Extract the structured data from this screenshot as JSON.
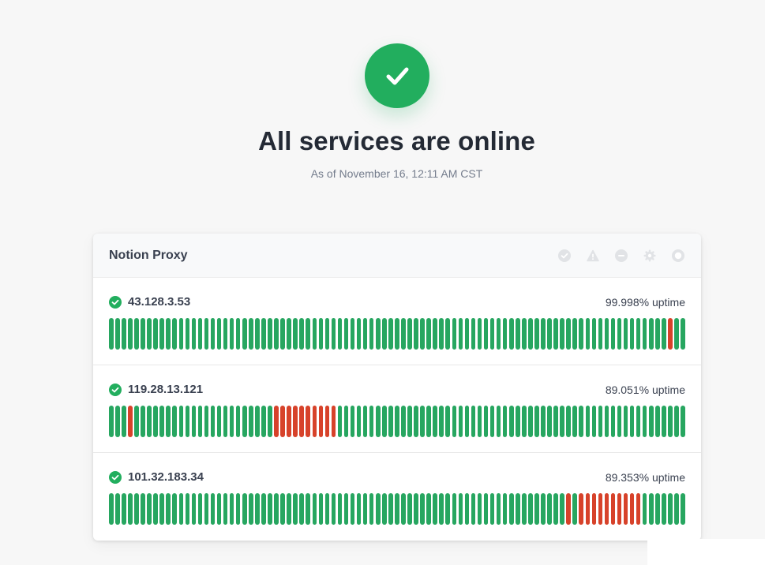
{
  "hero": {
    "status_title": "All services are online",
    "as_of": "As of November 16, 12:11 AM CST"
  },
  "group": {
    "title": "Notion Proxy",
    "legend_icons": [
      "operational-icon",
      "degraded-icon",
      "outage-icon",
      "maintenance-icon",
      "unknown-icon"
    ]
  },
  "colors": {
    "up": "#27a660",
    "down": "#d7422a",
    "accent": "#22ae5e"
  },
  "monitors": [
    {
      "name": "43.128.3.53",
      "uptime": "99.998% uptime",
      "bars": [
        1,
        1,
        1,
        1,
        1,
        1,
        1,
        1,
        1,
        1,
        1,
        1,
        1,
        1,
        1,
        1,
        1,
        1,
        1,
        1,
        1,
        1,
        1,
        1,
        1,
        1,
        1,
        1,
        1,
        1,
        1,
        1,
        1,
        1,
        1,
        1,
        1,
        1,
        1,
        1,
        1,
        1,
        1,
        1,
        1,
        1,
        1,
        1,
        1,
        1,
        1,
        1,
        1,
        1,
        1,
        1,
        1,
        1,
        1,
        1,
        1,
        1,
        1,
        1,
        1,
        1,
        1,
        1,
        1,
        1,
        1,
        1,
        1,
        1,
        1,
        1,
        1,
        1,
        1,
        1,
        1,
        1,
        1,
        1,
        1,
        1,
        1,
        1,
        0,
        1,
        1
      ]
    },
    {
      "name": "119.28.13.121",
      "uptime": "89.051% uptime",
      "bars": [
        1,
        1,
        1,
        0,
        1,
        1,
        1,
        1,
        1,
        1,
        1,
        1,
        1,
        1,
        1,
        1,
        1,
        1,
        1,
        1,
        1,
        1,
        1,
        1,
        1,
        1,
        0,
        0,
        0,
        0,
        0,
        0,
        0,
        0,
        0,
        0,
        1,
        1,
        1,
        1,
        1,
        1,
        1,
        1,
        1,
        1,
        1,
        1,
        1,
        1,
        1,
        1,
        1,
        1,
        1,
        1,
        1,
        1,
        1,
        1,
        1,
        1,
        1,
        1,
        1,
        1,
        1,
        1,
        1,
        1,
        1,
        1,
        1,
        1,
        1,
        1,
        1,
        1,
        1,
        1,
        1,
        1,
        1,
        1,
        1,
        1,
        1,
        1,
        1,
        1,
        1
      ]
    },
    {
      "name": "101.32.183.34",
      "uptime": "89.353% uptime",
      "bars": [
        1,
        1,
        1,
        1,
        1,
        1,
        1,
        1,
        1,
        1,
        1,
        1,
        1,
        1,
        1,
        1,
        1,
        1,
        1,
        1,
        1,
        1,
        1,
        1,
        1,
        1,
        1,
        1,
        1,
        1,
        1,
        1,
        1,
        1,
        1,
        1,
        1,
        1,
        1,
        1,
        1,
        1,
        1,
        1,
        1,
        1,
        1,
        1,
        1,
        1,
        1,
        1,
        1,
        1,
        1,
        1,
        1,
        1,
        1,
        1,
        1,
        1,
        1,
        1,
        1,
        1,
        1,
        1,
        1,
        1,
        1,
        1,
        0,
        1,
        0,
        0,
        0,
        0,
        0,
        0,
        0,
        0,
        0,
        0,
        1,
        1,
        1,
        1,
        1,
        1,
        1
      ]
    }
  ]
}
